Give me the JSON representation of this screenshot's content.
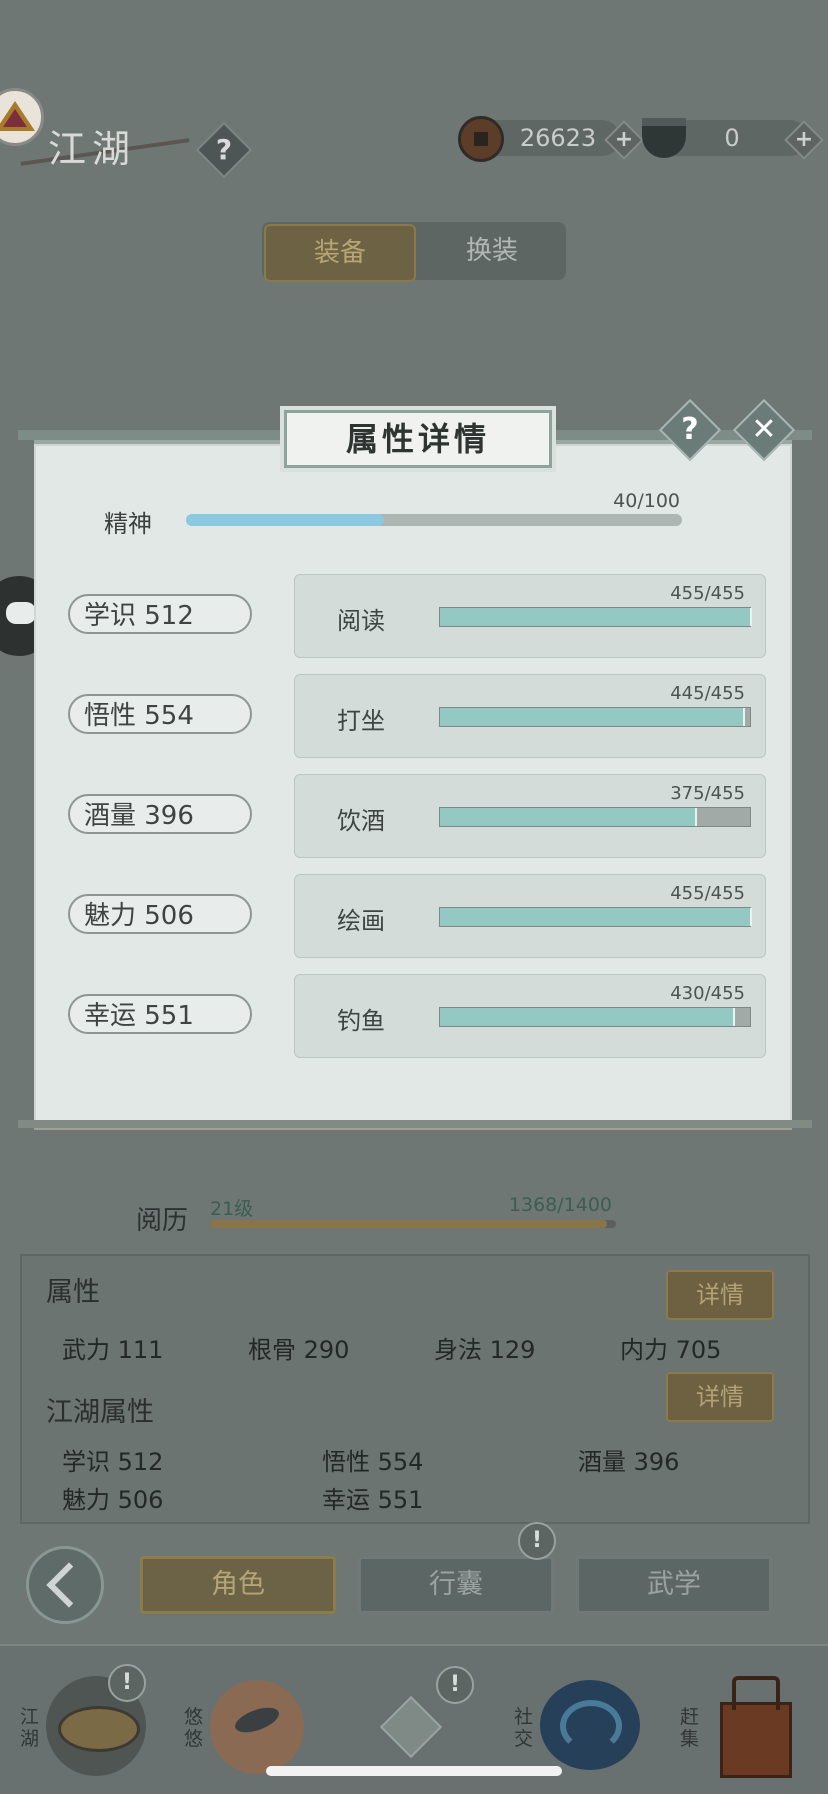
{
  "header": {
    "title": "江湖",
    "help_symbol": "?",
    "currency": [
      {
        "value": "26623",
        "icon": "copper-coin-icon"
      },
      {
        "value": "0",
        "icon": "silver-ingot-icon"
      }
    ],
    "plus_symbol": "+"
  },
  "tabs": {
    "equip": "装备",
    "swap": "换装"
  },
  "modal": {
    "title": "属性详情",
    "help_symbol": "?",
    "close_symbol": "✕",
    "spirit": {
      "label": "精神",
      "value_text": "40/100",
      "fraction": 0.4
    },
    "rows": [
      {
        "stat": "学识  512",
        "skill": "阅读",
        "progress": "455/455",
        "fraction": 1.0
      },
      {
        "stat": "悟性  554",
        "skill": "打坐",
        "progress": "445/455",
        "fraction": 0.978
      },
      {
        "stat": "酒量  396",
        "skill": "饮酒",
        "progress": "375/455",
        "fraction": 0.824
      },
      {
        "stat": "魅力  506",
        "skill": "绘画",
        "progress": "455/455",
        "fraction": 1.0
      },
      {
        "stat": "幸运  551",
        "skill": "钓鱼",
        "progress": "430/455",
        "fraction": 0.945
      }
    ]
  },
  "experience": {
    "label": "阅历",
    "level": "21级",
    "value_text": "1368/1400",
    "fraction": 0.977
  },
  "attributes": {
    "title": "属性",
    "detail_label": "详情",
    "items": [
      "武力  111",
      "根骨  290",
      "身法  129",
      "内力  705"
    ]
  },
  "jianghu_attributes": {
    "title": "江湖属性",
    "detail_label": "详情",
    "items": [
      "学识  512",
      "悟性  554",
      "酒量  396",
      "魅力  506",
      "幸运  551"
    ]
  },
  "nav": {
    "role": "角色",
    "bag": "行囊",
    "martial": "武学",
    "alert_symbol": "!"
  },
  "bottom_bar": {
    "items": [
      {
        "label": "江湖",
        "icon": "jianghu-hat-icon"
      },
      {
        "label": "悠悠",
        "icon": "swallow-icon"
      },
      {
        "label": "",
        "icon": "shuriken-icon"
      },
      {
        "label": "社交",
        "icon": "wave-icon"
      },
      {
        "label": "赶集",
        "icon": "market-box-icon"
      }
    ]
  }
}
